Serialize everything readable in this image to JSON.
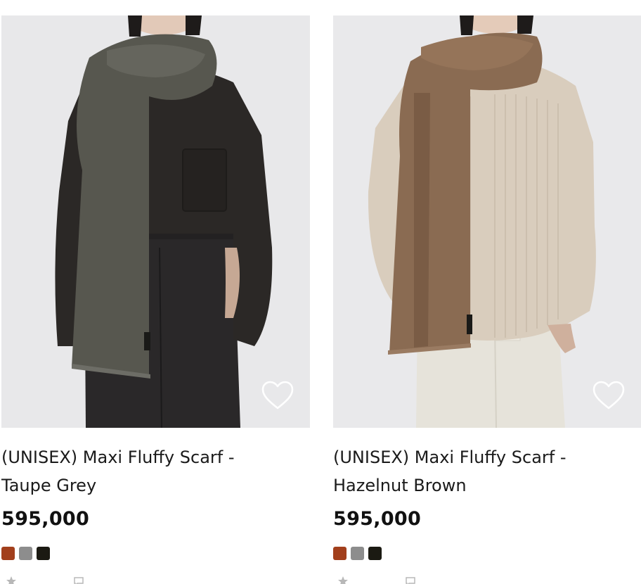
{
  "products": [
    {
      "title": "(UNISEX) Maxi Fluffy Scarf - Taupe Grey",
      "price": "595,000",
      "wishlist_icon": "heart-outline-icon",
      "swatches": [
        {
          "color": "#a23f1c"
        },
        {
          "color": "#8d8d8d"
        },
        {
          "color": "#1b1a12"
        }
      ]
    },
    {
      "title": "(UNISEX) Maxi Fluffy Scarf - Hazelnut Brown",
      "price": "595,000",
      "wishlist_icon": "heart-outline-icon",
      "swatches": [
        {
          "color": "#a23f1c"
        },
        {
          "color": "#8d8d8d"
        },
        {
          "color": "#1b1a12"
        }
      ]
    }
  ],
  "icons": {
    "rating": "star-icon",
    "reviews": "comment-icon"
  }
}
